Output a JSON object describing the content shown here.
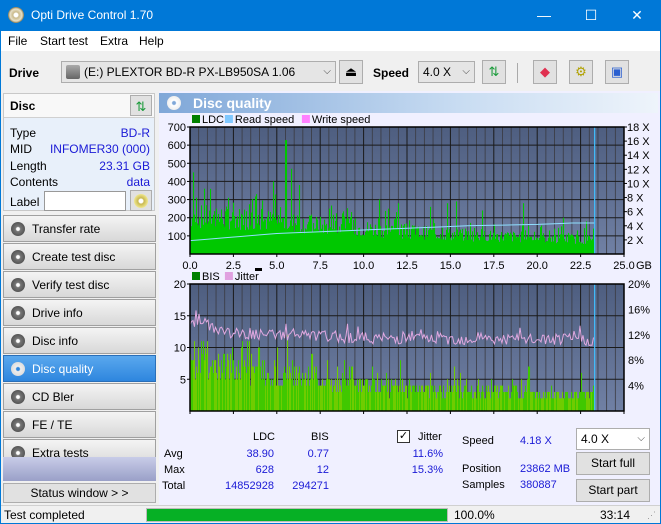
{
  "window": {
    "title": "Opti Drive Control 1.70",
    "minimize": "—",
    "maximize": "☐",
    "close": "✕"
  },
  "menu": [
    "File",
    "Start test",
    "Extra",
    "Help"
  ],
  "toolbar": {
    "drive_label": "Drive",
    "drive_value": "(E:)  PLEXTOR BD-R  PX-LB950SA 1.06",
    "speed_label": "Speed",
    "speed_value": "4.0 X",
    "eject": "⏏"
  },
  "disc": {
    "header": "Disc",
    "rows": [
      {
        "k": "Type",
        "v": "BD-R"
      },
      {
        "k": "MID",
        "v": "INFOMER30 (000)"
      },
      {
        "k": "Length",
        "v": "23.31 GB"
      },
      {
        "k": "Contents",
        "v": "data"
      }
    ],
    "label_caption": "Label",
    "label_value": ""
  },
  "nav": [
    {
      "label": "Transfer rate"
    },
    {
      "label": "Create test disc"
    },
    {
      "label": "Verify test disc"
    },
    {
      "label": "Drive info"
    },
    {
      "label": "Disc info"
    },
    {
      "label": "Disc quality",
      "active": true
    },
    {
      "label": "CD Bler"
    },
    {
      "label": "FE / TE"
    },
    {
      "label": "Extra tests"
    }
  ],
  "status_window": "Status window > >",
  "panel": {
    "title": "Disc quality"
  },
  "chart_data": [
    {
      "type": "area",
      "title": "LDC",
      "legend": [
        "LDC",
        "Read speed",
        "Write speed"
      ],
      "legend_colors": [
        "#008000",
        "#80c8ff",
        "#ff80ff"
      ],
      "xlabel": "GB",
      "xlim": [
        0,
        25
      ],
      "xticks": [
        "0.0",
        "2.5",
        "5.0",
        "7.5",
        "10.0",
        "12.5",
        "15.0",
        "17.5",
        "20.0",
        "22.5",
        "25.0"
      ],
      "ylim": [
        0,
        700
      ],
      "yticks": [
        "100",
        "200",
        "300",
        "400",
        "500",
        "600",
        "700"
      ],
      "y2lim": [
        0,
        18
      ],
      "y2ticks": [
        "2 X",
        "4 X",
        "6 X",
        "8 X",
        "10 X",
        "12 X",
        "14 X",
        "16 X",
        "18 X"
      ],
      "end_marker_gb": 23.31,
      "ldc_baseline": [
        [
          0,
          250
        ],
        [
          2.5,
          240
        ],
        [
          5,
          220
        ],
        [
          7.5,
          190
        ],
        [
          10,
          170
        ],
        [
          12.5,
          150
        ],
        [
          15,
          130
        ],
        [
          17.5,
          120
        ],
        [
          20,
          110
        ],
        [
          22.5,
          100
        ],
        [
          23.31,
          95
        ]
      ],
      "ldc_peaks": [
        [
          0.2,
          450
        ],
        [
          0.8,
          360
        ],
        [
          2.2,
          310
        ],
        [
          3.8,
          330
        ],
        [
          4.8,
          400
        ],
        [
          5.5,
          628
        ],
        [
          5.8,
          470
        ],
        [
          6.3,
          380
        ],
        [
          8.0,
          250
        ],
        [
          10.9,
          300
        ],
        [
          11.4,
          250
        ],
        [
          12.0,
          280
        ],
        [
          13.8,
          260
        ],
        [
          14.8,
          280
        ],
        [
          15.3,
          290
        ],
        [
          16.8,
          240
        ],
        [
          19.2,
          280
        ],
        [
          21.5,
          200
        ],
        [
          22.8,
          180
        ]
      ],
      "read_speed": [
        [
          0,
          1.9
        ],
        [
          1,
          2.1
        ],
        [
          2,
          2.3
        ],
        [
          3,
          2.5
        ],
        [
          4,
          2.7
        ],
        [
          5,
          2.9
        ],
        [
          6,
          3.0
        ],
        [
          7,
          3.1
        ],
        [
          8,
          3.2
        ],
        [
          9,
          3.3
        ],
        [
          10,
          3.4
        ],
        [
          11,
          3.5
        ],
        [
          12,
          3.6
        ],
        [
          13,
          3.7
        ],
        [
          14,
          3.8
        ],
        [
          15,
          3.9
        ],
        [
          16,
          4.0
        ],
        [
          17,
          4.05
        ],
        [
          18,
          4.1
        ],
        [
          19,
          4.15
        ],
        [
          20,
          4.2
        ],
        [
          21,
          4.3
        ],
        [
          22,
          4.4
        ],
        [
          23.31,
          4.4
        ]
      ]
    },
    {
      "type": "area",
      "title": "BIS",
      "legend": [
        "BIS",
        "Jitter"
      ],
      "legend_colors": [
        "#008000",
        "#e0a0e0"
      ],
      "xlabel": "GB",
      "xlim": [
        0,
        25
      ],
      "xticks": [
        "0.0",
        "2.5",
        "5.0",
        "7.5",
        "10.0",
        "12.5",
        "15.0",
        "17.5",
        "20.0",
        "22.5",
        "25.0"
      ],
      "ylim": [
        0,
        20
      ],
      "yticks": [
        "5",
        "10",
        "15",
        "20"
      ],
      "y2lim": [
        0,
        20
      ],
      "y2ticks": [
        "4%",
        "8%",
        "12%",
        "16%",
        "20%"
      ],
      "end_marker_gb": 23.31,
      "bis_baseline": [
        [
          0,
          8
        ],
        [
          2.5,
          8
        ],
        [
          5,
          7
        ],
        [
          7.5,
          6
        ],
        [
          10,
          5
        ],
        [
          12.5,
          4
        ],
        [
          15,
          4
        ],
        [
          17.5,
          4
        ],
        [
          20,
          3
        ],
        [
          22.5,
          3
        ],
        [
          23.31,
          3
        ]
      ],
      "bis_peaks": [
        [
          1.0,
          11
        ],
        [
          2.4,
          10
        ],
        [
          3.0,
          11
        ],
        [
          5.6,
          12
        ],
        [
          7.0,
          9
        ],
        [
          10.5,
          7
        ],
        [
          12.1,
          8
        ],
        [
          15.2,
          7
        ],
        [
          19.5,
          7
        ],
        [
          22.5,
          6
        ]
      ],
      "jitter_pct": [
        [
          0,
          13.5
        ],
        [
          0.5,
          14.5
        ],
        [
          1,
          13.5
        ],
        [
          2,
          12.5
        ],
        [
          3,
          12.0
        ],
        [
          4,
          12.0
        ],
        [
          5,
          12.0
        ],
        [
          7.5,
          11.8
        ],
        [
          10,
          11.5
        ],
        [
          12.5,
          11.4
        ],
        [
          15,
          11.3
        ],
        [
          17.5,
          11.3
        ],
        [
          20,
          11.2
        ],
        [
          22.5,
          11.3
        ],
        [
          23.31,
          11.0
        ]
      ]
    }
  ],
  "stats": {
    "headers": [
      "",
      "LDC",
      "BIS"
    ],
    "rows": [
      {
        "k": "Avg",
        "ldc": "38.90",
        "bis": "0.77",
        "jitter": "11.6%"
      },
      {
        "k": "Max",
        "ldc": "628",
        "bis": "12",
        "jitter": "15.3%"
      },
      {
        "k": "Total",
        "ldc": "14852928",
        "bis": "294271"
      }
    ],
    "jitter_label": "Jitter",
    "jitter_checked": true
  },
  "info": {
    "speed_label": "Speed",
    "speed_value": "4.18 X",
    "position_label": "Position",
    "position_value": "23862 MB",
    "samples_label": "Samples",
    "samples_value": "380887",
    "speed_select": "4.0 X"
  },
  "buttons": {
    "start_full": "Start full",
    "start_part": "Start part"
  },
  "statusbar": {
    "text": "Test completed",
    "progress": 100.0,
    "progress_text": "100.0%",
    "time": "33:14",
    "color": "#06b025"
  }
}
